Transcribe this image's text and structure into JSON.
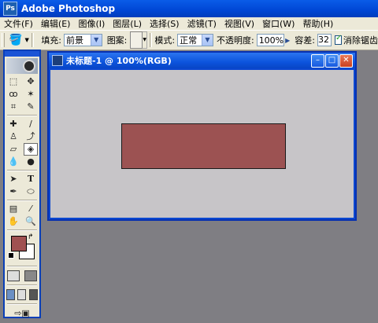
{
  "app": {
    "title": "Adobe Photoshop",
    "logo_text": "Ps"
  },
  "menu": [
    "文件(F)",
    "编辑(E)",
    "图像(I)",
    "图层(L)",
    "选择(S)",
    "滤镜(T)",
    "视图(V)",
    "窗口(W)",
    "帮助(H)"
  ],
  "options": {
    "fill_label": "填充:",
    "fill_value": "前景",
    "pattern_label": "图案:",
    "mode_label": "模式:",
    "mode_value": "正常",
    "opacity_label": "不透明度:",
    "opacity_value": "100%",
    "tolerance_label": "容差:",
    "tolerance_value": "32",
    "antialias_label": "消除锯齿"
  },
  "document": {
    "title": "未标题-1 @ 100%(RGB)",
    "rect_color": "#9c5252",
    "canvas_color": "#c7c5c8"
  },
  "colors": {
    "foreground": "#a05151",
    "background": "#ffffff",
    "workspace": "#7f7e83"
  },
  "toolbox": {
    "active_tool": "paint-bucket",
    "tools": [
      [
        "marquee",
        "move"
      ],
      [
        "lasso",
        "magic-wand"
      ],
      [
        "crop",
        "slice"
      ],
      [
        "healing-brush",
        "brush"
      ],
      [
        "clone-stamp",
        "history-brush"
      ],
      [
        "eraser",
        "paint-bucket"
      ],
      [
        "blur",
        "dodge"
      ],
      [
        "path-selection",
        "type"
      ],
      [
        "pen",
        "shape"
      ],
      [
        "notes",
        "eyedropper"
      ],
      [
        "hand",
        "zoom"
      ]
    ]
  }
}
